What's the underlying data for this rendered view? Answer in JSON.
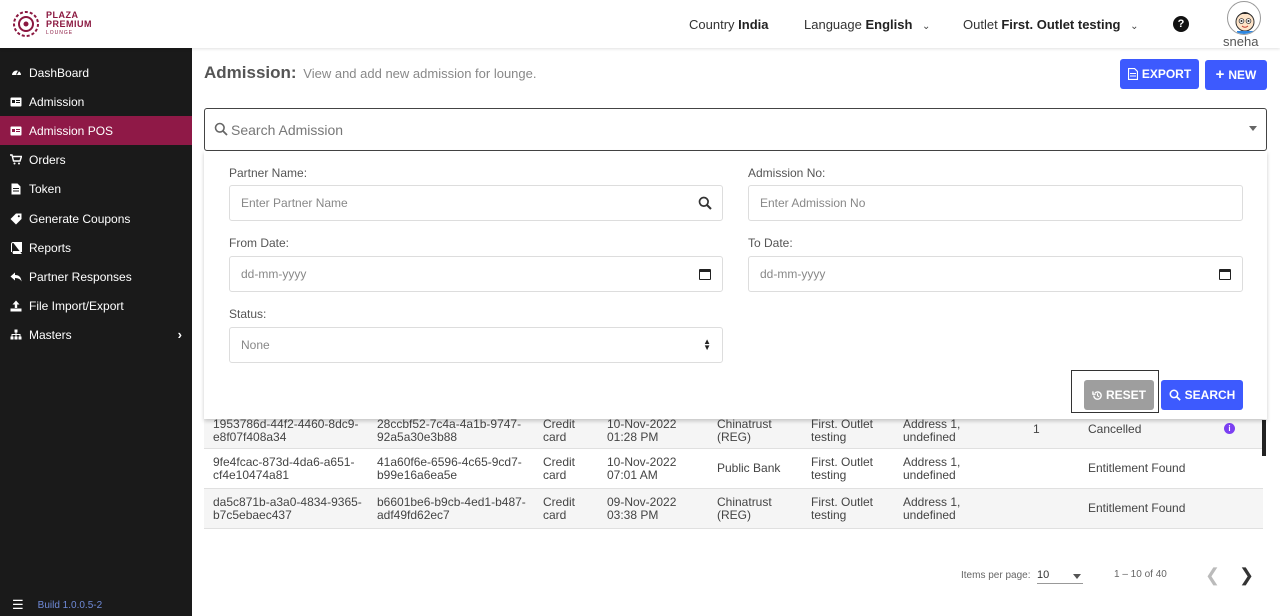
{
  "brand": {
    "line1": "PLAZA",
    "line2": "PREMIUM",
    "line3": "LOUNGE",
    "color": "#8b1840"
  },
  "header": {
    "country_label": "Country",
    "country_value": "India",
    "language_label": "Language",
    "language_value": "English",
    "outlet_label": "Outlet",
    "outlet_value": "First. Outlet testing",
    "help_icon": "?",
    "username": "sneha"
  },
  "sidebar": {
    "items": [
      {
        "label": "DashBoard",
        "icon": "dashboard-icon"
      },
      {
        "label": "Admission",
        "icon": "id-card-icon"
      },
      {
        "label": "Admission POS",
        "icon": "id-card-icon",
        "active": true
      },
      {
        "label": "Orders",
        "icon": "cart-icon"
      },
      {
        "label": "Token",
        "icon": "file-icon"
      },
      {
        "label": "Generate Coupons",
        "icon": "tag-icon"
      },
      {
        "label": "Reports",
        "icon": "book-icon"
      },
      {
        "label": "Partner Responses",
        "icon": "reply-icon"
      },
      {
        "label": "File Import/Export",
        "icon": "upload-icon"
      },
      {
        "label": "Masters",
        "icon": "sitemap-icon",
        "has_arrow": true
      }
    ],
    "build": "Build 1.0.0.5-2",
    "active_color": "#8f1947"
  },
  "main": {
    "title": "Admission:",
    "subtitle": "View and add new admission for lounge.",
    "export_label": "EXPORT",
    "new_label": "NEW",
    "search_placeholder": "Search Admission"
  },
  "filters": {
    "partner_name_label": "Partner Name:",
    "partner_name_placeholder": "Enter Partner Name",
    "admission_no_label": "Admission No:",
    "admission_no_placeholder": "Enter Admission No",
    "from_date_label": "From Date:",
    "from_date_placeholder": "dd-mm-yyyy",
    "to_date_label": "To Date:",
    "to_date_placeholder": "dd-mm-yyyy",
    "status_label": "Status:",
    "status_value": "None",
    "reset_label": "RESET",
    "search_label": "SEARCH"
  },
  "table": {
    "rows": [
      {
        "id1": "1953786d-44f2-4460-8dc9-",
        "id1b": "e8f07f408a34",
        "id2": "28ccbf52-7c4a-4a1b-9747-",
        "id2b": "92a5a30e3b88",
        "type1": "Credit",
        "type2": "card",
        "date1": "10-Nov-2022",
        "date2": "01:28 PM",
        "partner1": "Chinatrust",
        "partner2": "(REG)",
        "outlet1": "First. Outlet",
        "outlet2": "testing",
        "addr1": "Address 1,",
        "addr2": "undefined",
        "count": "1",
        "status": "Cancelled",
        "info": true
      },
      {
        "id1": "9fe4fcac-873d-4da6-a651-",
        "id1b": "cf4e10474a81",
        "id2": "41a60f6e-6596-4c65-9cd7-",
        "id2b": "b99e16a6ea5e",
        "type1": "Credit",
        "type2": "card",
        "date1": "10-Nov-2022",
        "date2": "07:01 AM",
        "partner1": "Public Bank",
        "partner2": "",
        "outlet1": "First. Outlet",
        "outlet2": "testing",
        "addr1": "Address 1,",
        "addr2": "undefined",
        "count": "",
        "status": "Entitlement Found",
        "info": false
      },
      {
        "id1": "da5c871b-a3a0-4834-9365-",
        "id1b": "b7c5ebaec437",
        "id2": "b6601be6-b9cb-4ed1-b487-",
        "id2b": "adf49fd62ec7",
        "type1": "Credit",
        "type2": "card",
        "date1": "09-Nov-2022",
        "date2": "03:38 PM",
        "partner1": "Chinatrust",
        "partner2": "(REG)",
        "outlet1": "First. Outlet",
        "outlet2": "testing",
        "addr1": "Address 1,",
        "addr2": "undefined",
        "count": "",
        "status": "Entitlement Found",
        "info": false
      }
    ]
  },
  "paginator": {
    "items_per_page_label": "Items per page:",
    "page_size": "10",
    "range": "1 – 10 of 40"
  },
  "colors": {
    "primary": "#3d5afe",
    "reset": "#9e9e9e",
    "info": "#7b3ff2"
  }
}
